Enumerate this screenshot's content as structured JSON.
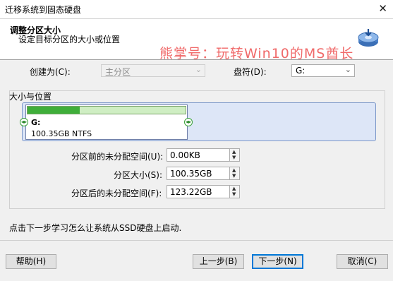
{
  "window": {
    "title": "迁移系统到固态硬盘",
    "close_glyph": "✕"
  },
  "header": {
    "title": "调整分区大小",
    "subtitle": "设定目标分区的大小或位置",
    "watermark": "熊掌号：玩转Win10的MS酋长",
    "logo_icon": "disk-migrate-icon"
  },
  "form": {
    "create_as_label": "创建为(C):",
    "create_as_value": "主分区",
    "drive_letter_label": "盘符(D):",
    "drive_letter_value": "G:"
  },
  "size_group": {
    "legend": "大小与位置",
    "partition_name": "G:",
    "partition_info": "100.35GB NTFS",
    "usage_fraction": 0.33,
    "fields": [
      {
        "label": "分区前的未分配空间(U):",
        "value": "0.00KB"
      },
      {
        "label": "分区大小(S):",
        "value": "100.35GB"
      },
      {
        "label": "分区后的未分配空间(F):",
        "value": "123.22GB"
      }
    ]
  },
  "hint": "点击下一步学习怎么让系统从SSD硬盘上启动.",
  "buttons": {
    "help": "帮助(H)",
    "back": "上一步(B)",
    "next": "下一步(N)",
    "cancel": "取消(C)"
  }
}
